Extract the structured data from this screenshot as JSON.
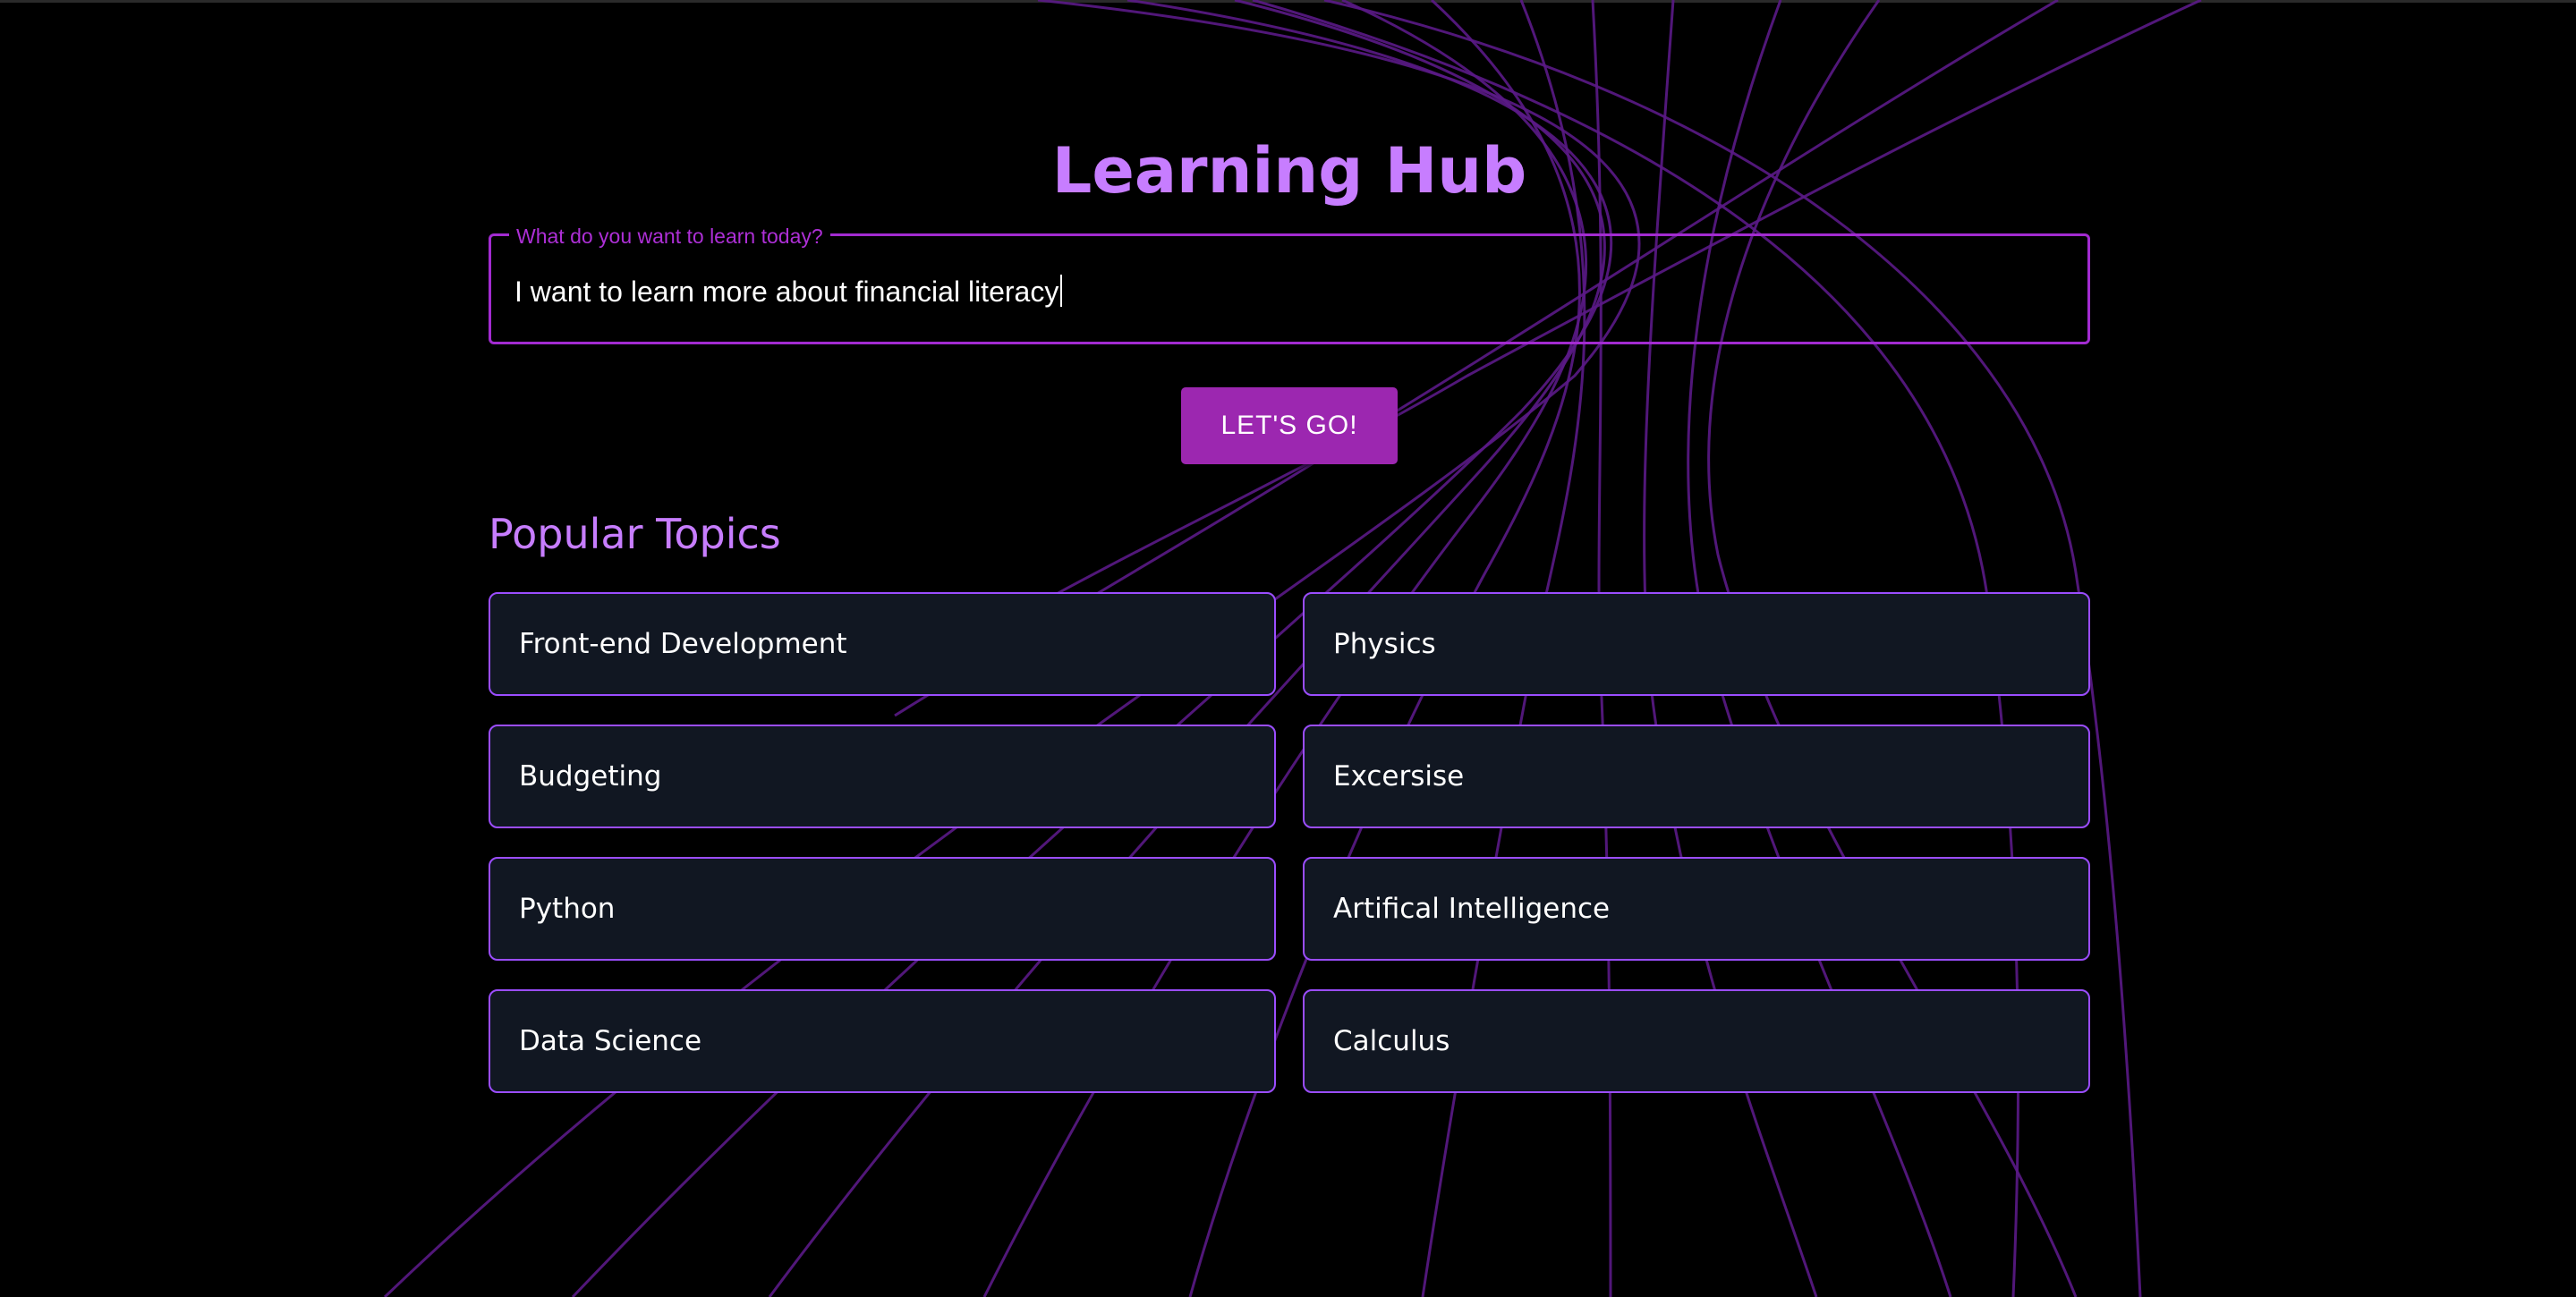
{
  "header": {
    "title": "Learning Hub"
  },
  "search": {
    "label": "What do you want to learn today?",
    "value": "I want to learn more about financial literacy"
  },
  "go_button": {
    "label": "LET'S GO!"
  },
  "popular": {
    "heading": "Popular Topics",
    "topics": [
      "Front-end Development",
      "Physics",
      "Budgeting",
      "Excersise",
      "Python",
      "Artifical Intelligence",
      "Data Science",
      "Calculus"
    ]
  },
  "colors": {
    "background": "#000000",
    "accent": "#c77dff",
    "button": "#9c27b0",
    "card_background": "#111722",
    "card_border": "#9b4dff",
    "field_border": "#a22bd0",
    "background_lines": "#5a1a86"
  },
  "decoration": {
    "background": "curved-purple-line-pattern"
  }
}
